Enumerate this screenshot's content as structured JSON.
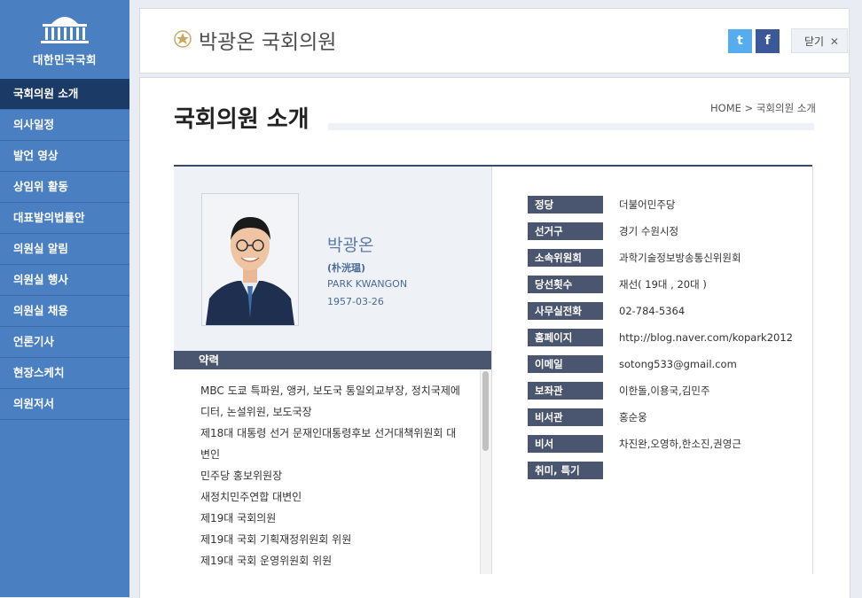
{
  "sidebar": {
    "logo_text": "대한민국국회",
    "items": [
      {
        "label": "국회의원 소개"
      },
      {
        "label": "의사일정"
      },
      {
        "label": "발언 영상"
      },
      {
        "label": "상임위 활동"
      },
      {
        "label": "대표발의법률안"
      },
      {
        "label": "의원실 알림"
      },
      {
        "label": "의원실 행사"
      },
      {
        "label": "의원실 채용"
      },
      {
        "label": "언론기사"
      },
      {
        "label": "현장스케치"
      },
      {
        "label": "의원저서"
      }
    ],
    "active_index": 0
  },
  "header": {
    "title": "박광온 국회의원",
    "twitter_icon": "t",
    "facebook_icon": "f",
    "close_label": "닫기",
    "close_icon": "✕"
  },
  "main": {
    "page_title": "국회의원 소개",
    "breadcrumb": "HOME > 국회의원 소개"
  },
  "profile": {
    "name": "박광온",
    "hanja": "(朴洸瑥)",
    "english_name": "PARK KWANGON",
    "birth": "1957-03-26",
    "career_header": "약력",
    "career": [
      "MBC 도쿄 특파원, 앵커, 보도국 통일외교부장, 정치국제에",
      "디터, 논설위원, 보도국장",
      "제18대 대통령 선거 문재인대통령후보 선거대책위원회 대",
      "변인",
      "민주당 홍보위원장",
      "새정치민주연합 대변인",
      "제19대 국회의원",
      "제19대 국회 기획재정위원회 위원",
      "제19대 국회 운영위원회 위원"
    ],
    "info": [
      {
        "label": "정당",
        "value": "더불어민주당"
      },
      {
        "label": "선거구",
        "value": "경기 수원시정"
      },
      {
        "label": "소속위원회",
        "value": "과학기술정보방송통신위원회"
      },
      {
        "label": "당선횟수",
        "value": "재선( 19대 , 20대 )"
      },
      {
        "label": "사무실전화",
        "value": "02-784-5364"
      },
      {
        "label": "홈페이지",
        "value": "http://blog.naver.com/kopark2012"
      },
      {
        "label": "이메일",
        "value": "sotong533@gmail.com"
      },
      {
        "label": "보좌관",
        "value": "이한돌,이용국,김민주"
      },
      {
        "label": "비서관",
        "value": "홍순웅"
      },
      {
        "label": "비서",
        "value": "차진완,오영하,한소진,권영근"
      },
      {
        "label": "취미, 특기",
        "value": ""
      }
    ]
  },
  "colors": {
    "sidebar_bg": "#4a7fc1",
    "sidebar_active": "#1c3a66",
    "label_bg": "#4a5570",
    "accent_text": "#5a7ba8"
  }
}
